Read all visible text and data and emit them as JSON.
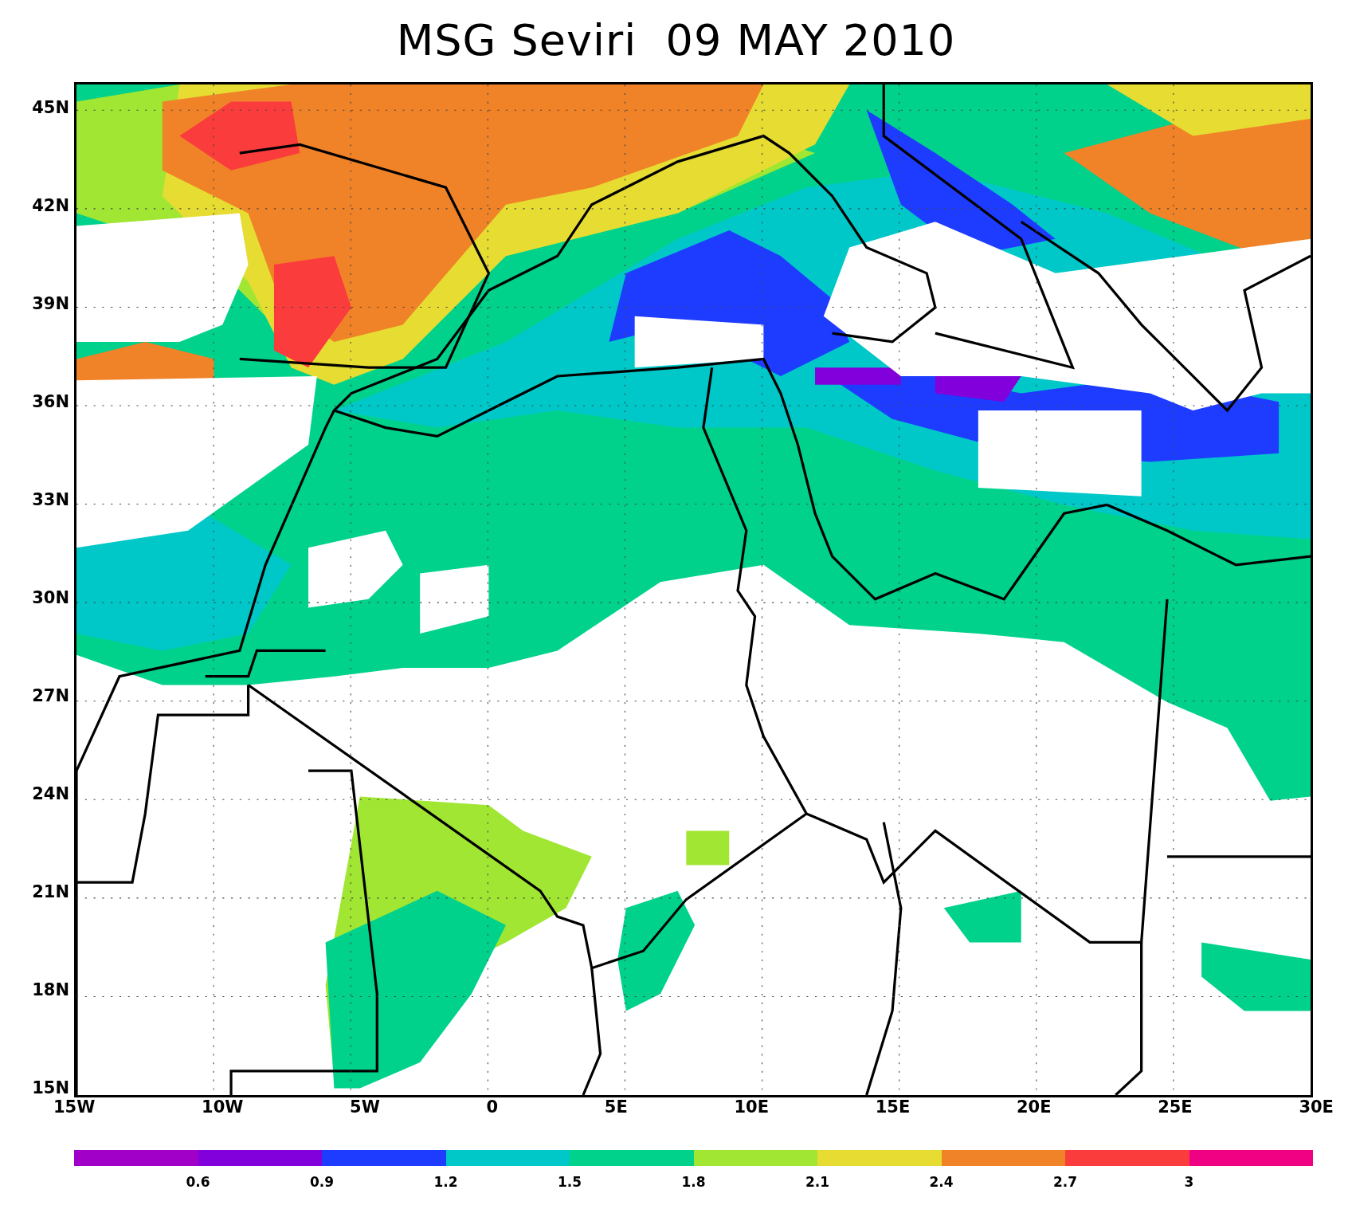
{
  "title": "MSG Seviri  09 MAY 2010",
  "map": {
    "y_ticks": [
      "45N",
      "42N",
      "39N",
      "36N",
      "33N",
      "30N",
      "27N",
      "24N",
      "21N",
      "18N",
      "15N"
    ],
    "x_ticks": [
      "15W",
      "10W",
      "5W",
      "0",
      "5E",
      "10E",
      "15E",
      "20E",
      "25E",
      "30E"
    ]
  },
  "colorbar": {
    "segments": [
      {
        "color": "#a000c8"
      },
      {
        "color": "#8200dc"
      },
      {
        "color": "#1e3cff"
      },
      {
        "color": "#00c8c8"
      },
      {
        "color": "#00d28c"
      },
      {
        "color": "#a0e632"
      },
      {
        "color": "#e6dc32"
      },
      {
        "color": "#f08228"
      },
      {
        "color": "#fa3c3c"
      },
      {
        "color": "#f00082"
      }
    ],
    "labels": [
      "0.6",
      "0.9",
      "1.2",
      "1.5",
      "1.8",
      "2.1",
      "2.4",
      "2.7",
      "3"
    ]
  }
}
